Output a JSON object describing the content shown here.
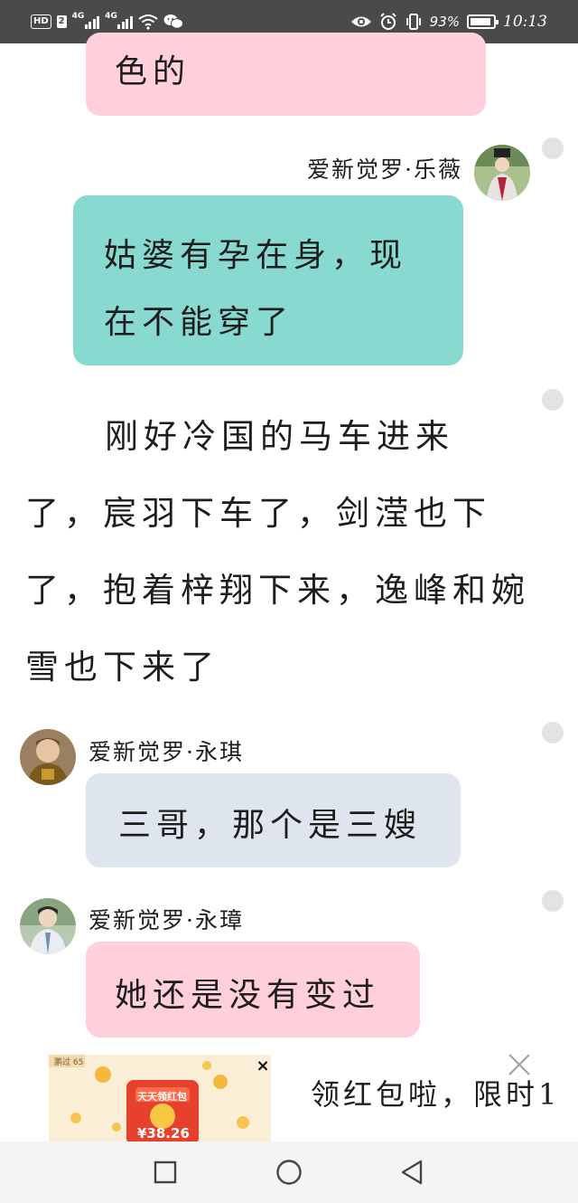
{
  "status_bar": {
    "hd": "HD",
    "sim": "2",
    "network_1": "4G",
    "network_2": "4G",
    "battery": "93%",
    "battery_level": 0.93,
    "time": "10:13"
  },
  "chat": {
    "messages": [
      {
        "sender": "",
        "text": "色的"
      },
      {
        "sender": "爱新觉罗·乐薇",
        "text": "姑婆有孕在身，现在不能穿了"
      },
      {
        "sender": "",
        "text": "刚好冷国的马车进来了，宸羽下车了，剑滢也下了，抱着梓翔下来，逸峰和婉雪也下来了"
      },
      {
        "sender": "爱新觉罗·永琪",
        "text": "三哥，那个是三嫂"
      },
      {
        "sender": "爱新觉罗·永璋",
        "text": "她还是没有变过"
      }
    ]
  },
  "ad": {
    "banner_badge": "鹏过 65",
    "banner_title": "天天领红包",
    "banner_amount": "¥38.26",
    "headline": "领红包啦，限时1"
  },
  "icons": {
    "wifi": "wifi-icon",
    "wechat": "wechat-icon",
    "eye": "eye-comfort-icon",
    "alarm": "alarm-icon",
    "vibrate": "vibrate-icon",
    "back": "back-icon",
    "home": "home-icon",
    "recents": "recents-icon"
  },
  "colors": {
    "pink_bubble": "#ffd0dc",
    "teal_bubble": "#88d9d0",
    "gray_bubble": "#dfe5ee",
    "status_bar": "#4a4a4a"
  }
}
